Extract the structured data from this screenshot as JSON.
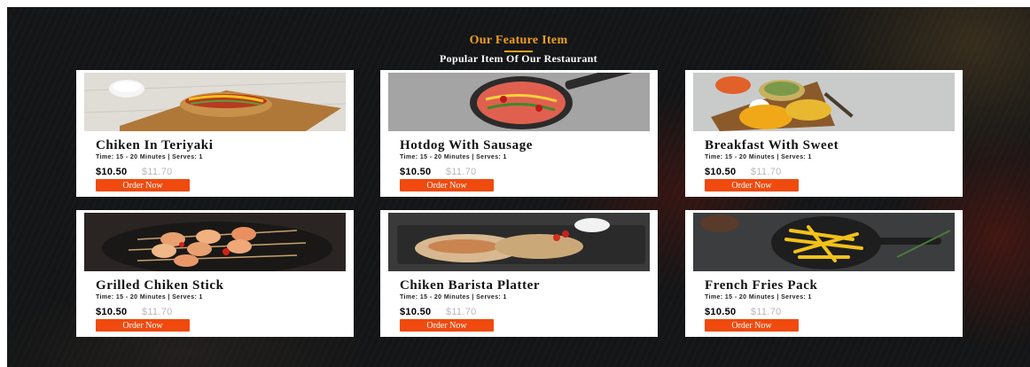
{
  "section": {
    "eyebrow": "Our Feature Item",
    "title": "Popular Item Of Our Restaurant"
  },
  "items": [
    {
      "name": "Chiken In Teriyaki",
      "meta": "Time: 15 - 20 Minutes | Serves: 1",
      "price": "$10.50",
      "old_price": "$11.70",
      "button": "Order Now"
    },
    {
      "name": "Hotdog With Sausage",
      "meta": "Time: 15 - 20 Minutes | Serves: 1",
      "price": "$10.50",
      "old_price": "$11.70",
      "button": "Order Now"
    },
    {
      "name": "Breakfast With Sweet",
      "meta": "Time: 15 - 20 Minutes | Serves: 1",
      "price": "$10.50",
      "old_price": "$11.70",
      "button": "Order Now"
    },
    {
      "name": "Grilled Chiken Stick",
      "meta": "Time: 15 - 20 Minutes | Serves: 1",
      "price": "$10.50",
      "old_price": "$11.70",
      "button": "Order Now"
    },
    {
      "name": "Chiken Barista Platter",
      "meta": "Time: 15 - 20 Minutes | Serves: 1",
      "price": "$10.50",
      "old_price": "$11.70",
      "button": "Order Now"
    },
    {
      "name": "French Fries Pack",
      "meta": "Time: 15 - 20 Minutes | Serves: 1",
      "price": "$10.50",
      "old_price": "$11.70",
      "button": "Order Now"
    }
  ],
  "colors": {
    "accent": "#f0a020",
    "button": "#f04a0e",
    "background": "#141516"
  }
}
